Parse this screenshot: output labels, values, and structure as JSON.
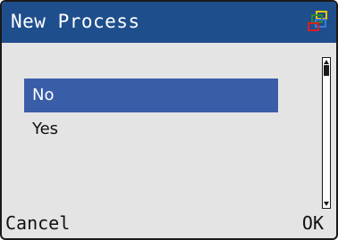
{
  "title_bar": {
    "title": "New Process",
    "icon": "windows-icon",
    "background_color": "#1f4e8c"
  },
  "list": {
    "items": [
      {
        "label": "No",
        "selected": true
      },
      {
        "label": "Yes",
        "selected": false
      }
    ],
    "selected_color": "#3a5da8"
  },
  "softkeys": {
    "left_label": "Cancel",
    "right_label": "OK"
  }
}
